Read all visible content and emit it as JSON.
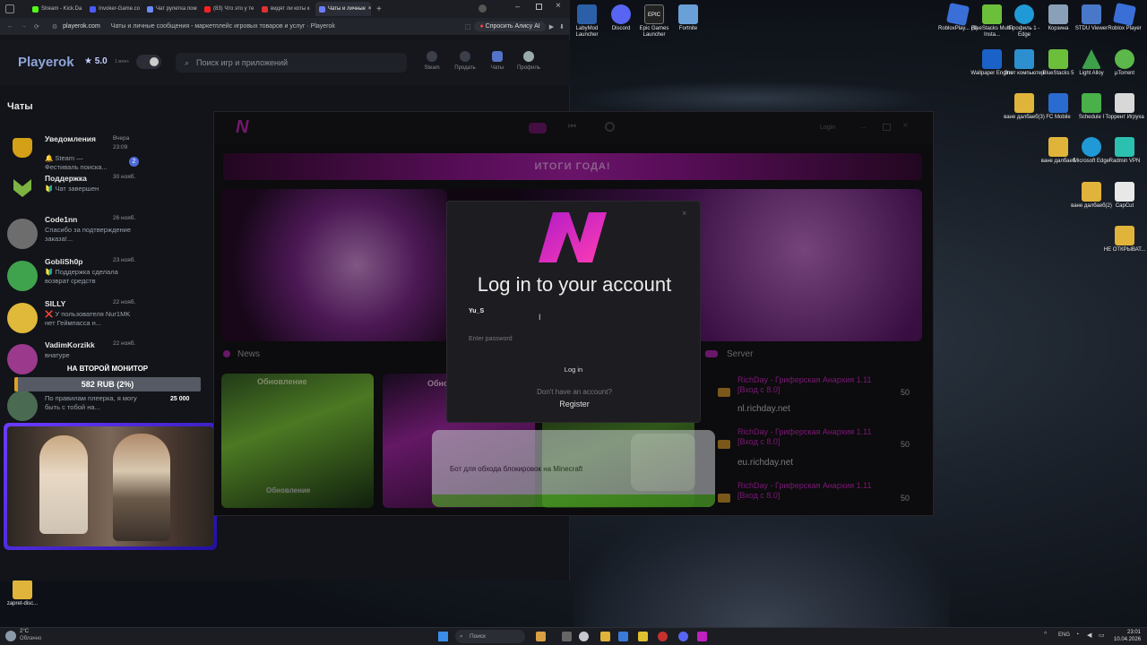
{
  "browser": {
    "tabs": [
      {
        "label": "Stream - Kick.Da",
        "color": "#53fc18"
      },
      {
        "label": "Invoker-Game.co",
        "color": "#4a5cff"
      },
      {
        "label": "Чат рулетка пом",
        "color": "#6b8cff"
      },
      {
        "label": "(83) Что это у те",
        "color": "#ff2020"
      },
      {
        "label": "видят ли коты к",
        "color": "#e03030"
      },
      {
        "label": "Чаты и личные",
        "color": "#6c7cff",
        "active": true
      }
    ],
    "url": "playerok.com",
    "page_title": "Чаты и личные сообщения - маркетплейс игровых товаров и услуг · Playerok",
    "ask_ai": "Спросить Алису AI"
  },
  "site": {
    "logo": "Playerok",
    "rating": "★ 5.0",
    "rating_sub": "1 млн+",
    "search_placeholder": "Поиск игр и приложений",
    "nav": [
      {
        "label": "Steam"
      },
      {
        "label": "Продать"
      },
      {
        "label": "Чаты"
      },
      {
        "label": "Профиль"
      }
    ],
    "chats_title": "Чаты",
    "chats": [
      {
        "name": "Уведомления",
        "date": "Вчера 23:09",
        "preview": "🔔 Steam — Фестиваль поиска...",
        "badge": "2",
        "avatar_color": "#d4a017"
      },
      {
        "name": "Поддержка",
        "date": "30 нояб.",
        "preview": "🔰 Чат завершен",
        "avatar_color": "#7cb342"
      },
      {
        "name": "Code1nn",
        "date": "26 нояб.",
        "preview": "Спасибо за подтверждение заказа!...",
        "avatar_color": "#6d6d6d"
      },
      {
        "name": "GobliSh0p",
        "date": "23 нояб.",
        "preview": "🔰 Поддержка сделала возврат средств",
        "avatar_color": "#3fa34d"
      },
      {
        "name": "SILLY",
        "date": "22 нояб.",
        "preview": "❌ У пользователя Nur1MK нет Геймпасса н...",
        "avatar_color": "#e0b83a"
      },
      {
        "name": "VadimKorzikk",
        "date": "22 нояб.",
        "preview": "внатуре",
        "avatar_color": "#9b3a8c"
      },
      {
        "name": "",
        "date": "",
        "preview": "По правилам плеерка, я могу быть с тобой на...",
        "avatar_color": "#4a6b52"
      }
    ]
  },
  "overlay": {
    "monitor_label": "НА ВТОРОЙ МОНИТОР",
    "donation": "582 RUB (2%)",
    "goal": "25 000",
    "progress_percent": 2
  },
  "app": {
    "login_btn": "Login",
    "banner": "ИТОГИ ГОДА!",
    "news_label": "News",
    "server_label": "Server",
    "news_items": [
      {
        "title": "Обновление"
      },
      {
        "title": "Обновление"
      },
      {
        "title": "Обновление"
      }
    ],
    "promo": "Бот для обхода блокировок на Minecraft",
    "servers": [
      {
        "name": "RichDay - Гриферская Анархия 1.11 [Вход с 8.0]",
        "host": "nl.richday.net",
        "count": "50"
      },
      {
        "name": "RichDay - Гриферская Анархия 1.11 [Вход с 8.0]",
        "host": "eu.richday.net",
        "count": "50"
      },
      {
        "name": "RichDay - Гриферская Анархия 1.11 [Вход с 8.0]",
        "host": "",
        "count": "50"
      }
    ]
  },
  "modal": {
    "title": "Log in to your account",
    "username_value": "Yu_S",
    "password_placeholder": "Enter password",
    "login_button": "Log in",
    "no_account": "Don't have an account?",
    "register": "Register",
    "close": "×"
  },
  "desktop_icons": [
    {
      "label": "LabyMod Launcher",
      "color": "#2b5fa8"
    },
    {
      "label": "Discord",
      "color": "#5865f2"
    },
    {
      "label": "Epic Games Launcher",
      "color": "#222222"
    },
    {
      "label": "Fortnite",
      "color": "#6aa0d8"
    },
    {
      "label": "RobloxPlay... (1)",
      "color": "#3a6fd8"
    },
    {
      "label": "BlueStacks Multi-Insta...",
      "color": "#6cbf3a"
    },
    {
      "label": "Профиль 1 - Edge",
      "color": "#1f9ad6"
    },
    {
      "label": "Корзина",
      "color": "#8aa0b8"
    },
    {
      "label": "STDU Viewer",
      "color": "#4a78c8"
    },
    {
      "label": "Roblox Player",
      "color": "#3a6fd8"
    },
    {
      "label": "Wallpaper Engine",
      "color": "#1a62c8"
    },
    {
      "label": "Этот компьютер",
      "color": "#2c8fd0"
    },
    {
      "label": "BlueStacks 5",
      "color": "#6cbf3a"
    },
    {
      "label": "Light Alloy",
      "color": "#3ea04a"
    },
    {
      "label": "µTorrent",
      "color": "#5cb84a"
    },
    {
      "label": "ване далбаеб(3)",
      "color": "#e0b43a"
    },
    {
      "label": "FC Mobile",
      "color": "#2a6bd0"
    },
    {
      "label": "Schedule I",
      "color": "#4ab04a"
    },
    {
      "label": "Торрент Игруха",
      "color": "#d8d8d8"
    },
    {
      "label": "ване далбаеб",
      "color": "#e0b43a"
    },
    {
      "label": "Microsoft Edge",
      "color": "#1f9ad6"
    },
    {
      "label": "Radmin VPN",
      "color": "#2cc0b0"
    },
    {
      "label": "ване далбаеб(2)",
      "color": "#e0b43a"
    },
    {
      "label": "CapCut",
      "color": "#e8e8e8"
    },
    {
      "label": "НЕ ОТКРЫВАТ...",
      "color": "#e0b43a"
    },
    {
      "label": "zapret-disc...",
      "color": "#e0b43a"
    }
  ],
  "taskbar": {
    "weather_temp": "2°C",
    "weather_desc": "Облачно",
    "search_label": "Поиск",
    "lang": "ENG",
    "time": "23:01",
    "date": "10.04.2026"
  }
}
